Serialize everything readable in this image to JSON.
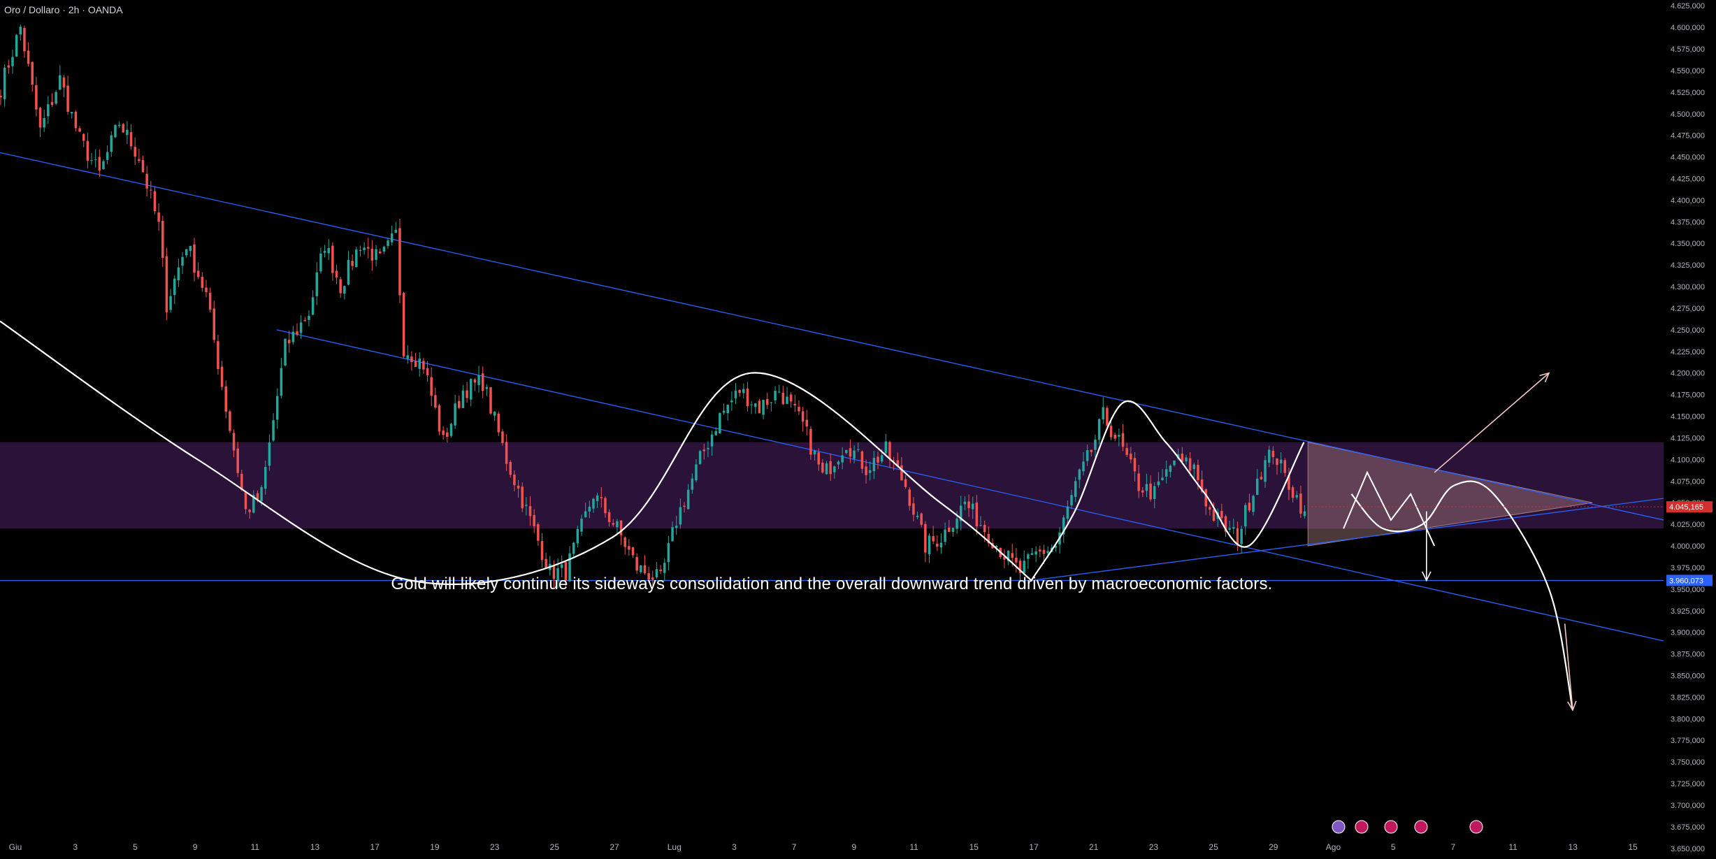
{
  "header": {
    "symbol": "Oro / Dollaro · 2h · OANDA"
  },
  "annotation": {
    "text": "Gold will likely continue its sideways consolidation and the overall downward trend driven by macroeconomic factors."
  },
  "colors": {
    "background": "#000000",
    "bull": "#26a69a",
    "bear": "#ef5350",
    "trendline": "#2962ff",
    "zone": "#2a1238",
    "projection": "#ffffff",
    "wedge_fill": "#a67c7c",
    "price_tag": "#d32f2f",
    "support_tag": "#2962ff",
    "axis_text": "#b2b5be"
  },
  "chart_data": {
    "type": "candlestick",
    "instrument": "Oro / Dollaro",
    "timeframe": "2h",
    "broker": "OANDA",
    "x_ticks": [
      "Giu",
      "3",
      "5",
      "9",
      "11",
      "13",
      "17",
      "19",
      "23",
      "25",
      "27",
      "Lug",
      "3",
      "7",
      "9",
      "11",
      "15",
      "17",
      "21",
      "23",
      "25",
      "29",
      "Ago",
      "5",
      "7",
      "11",
      "13",
      "15"
    ],
    "y_ticks": [
      "4.625,000",
      "4.600,000",
      "4.575,000",
      "4.550,000",
      "4.525,000",
      "4.500,000",
      "4.475,000",
      "4.450,000",
      "4.425,000",
      "4.400,000",
      "4.375,000",
      "4.350,000",
      "4.325,000",
      "4.300,000",
      "4.275,000",
      "4.250,000",
      "4.225,000",
      "4.200,000",
      "4.175,000",
      "4.150,000",
      "4.125,000",
      "4.100,000",
      "4.075,000",
      "4.050,000",
      "4.025,000",
      "4.000,000",
      "3.975,000",
      "3.950,000",
      "3.925,000",
      "3.900,000",
      "3.875,000",
      "3.850,000",
      "3.825,000",
      "3.800,000",
      "3.775,000",
      "3.750,000",
      "3.725,000",
      "3.700,000",
      "3.675,000",
      "3.650,000"
    ],
    "ylim": [
      3645,
      4630
    ],
    "current_price_label": "4.045,165",
    "current_price": 4045.165,
    "secondary_price_label": "4.048,664",
    "secondary_price": 4048.664,
    "support_label": "3.960,073",
    "support_price": 3960.073,
    "zone": {
      "top": 4120,
      "bottom": 4020
    },
    "price_path": [
      [
        0,
        4530
      ],
      [
        5,
        4600
      ],
      [
        10,
        4480
      ],
      [
        15,
        4540
      ],
      [
        20,
        4470
      ],
      [
        25,
        4430
      ],
      [
        30,
        4490
      ],
      [
        35,
        4450
      ],
      [
        40,
        4370
      ],
      [
        42,
        4280
      ],
      [
        47,
        4350
      ],
      [
        52,
        4290
      ],
      [
        57,
        4160
      ],
      [
        62,
        4040
      ],
      [
        66,
        4060
      ],
      [
        72,
        4230
      ],
      [
        78,
        4270
      ],
      [
        82,
        4350
      ],
      [
        86,
        4300
      ],
      [
        91,
        4350
      ],
      [
        96,
        4330
      ],
      [
        100,
        4360
      ],
      [
        102,
        4230
      ],
      [
        107,
        4210
      ],
      [
        112,
        4120
      ],
      [
        117,
        4180
      ],
      [
        122,
        4190
      ],
      [
        128,
        4100
      ],
      [
        134,
        4030
      ],
      [
        139,
        3970
      ],
      [
        143,
        3970
      ],
      [
        150,
        4060
      ],
      [
        156,
        4020
      ],
      [
        161,
        3975
      ],
      [
        167,
        3960
      ],
      [
        171,
        4030
      ],
      [
        177,
        4100
      ],
      [
        182,
        4150
      ],
      [
        187,
        4180
      ],
      [
        192,
        4160
      ],
      [
        197,
        4180
      ],
      [
        203,
        4140
      ],
      [
        208,
        4080
      ],
      [
        214,
        4120
      ],
      [
        219,
        4090
      ],
      [
        224,
        4110
      ],
      [
        229,
        4070
      ],
      [
        234,
        4000
      ],
      [
        238,
        4010
      ],
      [
        244,
        4050
      ],
      [
        249,
        4020
      ],
      [
        254,
        3990
      ],
      [
        258,
        3970
      ],
      [
        262,
        3990
      ],
      [
        267,
        4000
      ],
      [
        272,
        4070
      ],
      [
        276,
        4110
      ],
      [
        279,
        4150
      ],
      [
        283,
        4120
      ],
      [
        288,
        4070
      ],
      [
        292,
        4060
      ],
      [
        297,
        4100
      ],
      [
        302,
        4090
      ],
      [
        306,
        4040
      ],
      [
        310,
        4020
      ],
      [
        313,
        4010
      ],
      [
        318,
        4080
      ],
      [
        322,
        4110
      ],
      [
        325,
        4080
      ],
      [
        330,
        4040
      ]
    ],
    "bars_shown": 330,
    "x_total_bars": 421,
    "trendlines": [
      {
        "from": [
          0,
          4455
        ],
        "to": [
          421,
          4030
        ]
      },
      {
        "from": [
          70,
          4250
        ],
        "to": [
          421,
          3890
        ]
      },
      {
        "from": [
          261,
          3960
        ],
        "to": [
          421,
          4055
        ]
      },
      {
        "from": [
          0,
          3960
        ],
        "to": [
          421,
          3960
        ]
      }
    ],
    "projection": {
      "large_arc": [
        [
          0,
          4260
        ],
        [
          50,
          4100
        ],
        [
          104,
          3960
        ],
        [
          155,
          4010
        ],
        [
          190,
          4200
        ],
        [
          238,
          4050
        ],
        [
          261,
          3960
        ]
      ],
      "middle_arc": [
        [
          261,
          3960
        ],
        [
          272,
          4040
        ],
        [
          284,
          4165
        ],
        [
          295,
          4120
        ],
        [
          305,
          4060
        ],
        [
          316,
          4000
        ],
        [
          330,
          4120
        ]
      ],
      "zigzag": [
        [
          340,
          4020
        ],
        [
          346,
          4085
        ],
        [
          352,
          4030
        ],
        [
          357,
          4060
        ],
        [
          363,
          4000
        ]
      ],
      "cup": [
        [
          342,
          4060
        ],
        [
          350,
          4020
        ],
        [
          360,
          4025
        ],
        [
          368,
          4070
        ],
        [
          378,
          4060
        ],
        [
          392,
          3950
        ],
        [
          398,
          3810
        ]
      ],
      "up_arrow": {
        "from": [
          363,
          4085
        ],
        "to": [
          392,
          4200
        ]
      },
      "down_arrow_small": {
        "from": [
          361,
          4040
        ],
        "to": [
          361,
          3960
        ]
      }
    },
    "wedge": {
      "upper": [
        [
          331,
          4120
        ],
        [
          403,
          4050
        ]
      ],
      "lower": [
        [
          331,
          4000
        ],
        [
          403,
          4050
        ]
      ]
    }
  }
}
